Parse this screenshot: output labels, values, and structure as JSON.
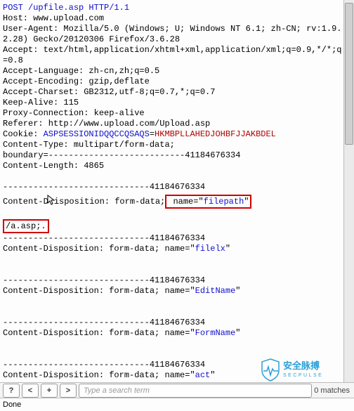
{
  "request": {
    "method_line": "POST /upfile.asp HTTP/1.1",
    "host": "www.upload.com",
    "user_agent": "Mozilla/5.0 (Windows; U; Windows NT 6.1; zh-CN; rv:1.9.2.28) Gecko/20120306 Firefox/3.6.28",
    "accept": "text/html,application/xhtml+xml,application/xml;q=0.9,*/*;q=0.8",
    "accept_language": "zh-cn,zh;q=0.5",
    "accept_encoding": "gzip,deflate",
    "accept_charset": "GB2312,utf-8;q=0.7,*;q=0.7",
    "keep_alive": "115",
    "proxy_connection": "keep-alive",
    "referer": "http://www.upload.com/Upload.asp",
    "cookie_name": "ASPSESSIONIDQQCCQSAQS",
    "cookie_value": "HKMBPLLAHEDJOHBFJJAKBDEL",
    "content_type": "multipart/form-data;",
    "boundary": "---------------------------41184676334",
    "content_length": "4865",
    "sep_line": "-----------------------------41184676334",
    "parts": [
      {
        "prefix": "Content-Disposition: form-data;",
        "name_key": " name=\"",
        "name_value": "filepath",
        "name_suffix": "\"",
        "body": "/a.asp;.",
        "highlight_name": true,
        "highlight_body": true,
        "cursor_after_prefix": true
      },
      {
        "prefix": "Content-Disposition: form-data; name=\"",
        "name_value": "filelx",
        "name_suffix": "\"",
        "body": "",
        "highlight_name": false,
        "highlight_body": false
      },
      {
        "prefix": "Content-Disposition: form-data; name=\"",
        "name_value": "EditName",
        "name_suffix": "\"",
        "body": "",
        "highlight_name": false,
        "highlight_body": false
      },
      {
        "prefix": "Content-Disposition: form-data; name=\"",
        "name_value": "FormName",
        "name_suffix": "\"",
        "body": "",
        "highlight_name": false,
        "highlight_body": false
      }
    ],
    "cutoff_line_prefix": "Content-Disposition: form-data; name=\"",
    "cutoff_line_value": "act"
  },
  "toolbar": {
    "buttons": [
      "?",
      "<",
      "+",
      ">"
    ],
    "search_placeholder": "Type a search term",
    "matches_label": "0 matches"
  },
  "status": {
    "text": "Done"
  },
  "logo": {
    "text_cn": "安全脉搏",
    "text_en": "SECPULSE"
  }
}
